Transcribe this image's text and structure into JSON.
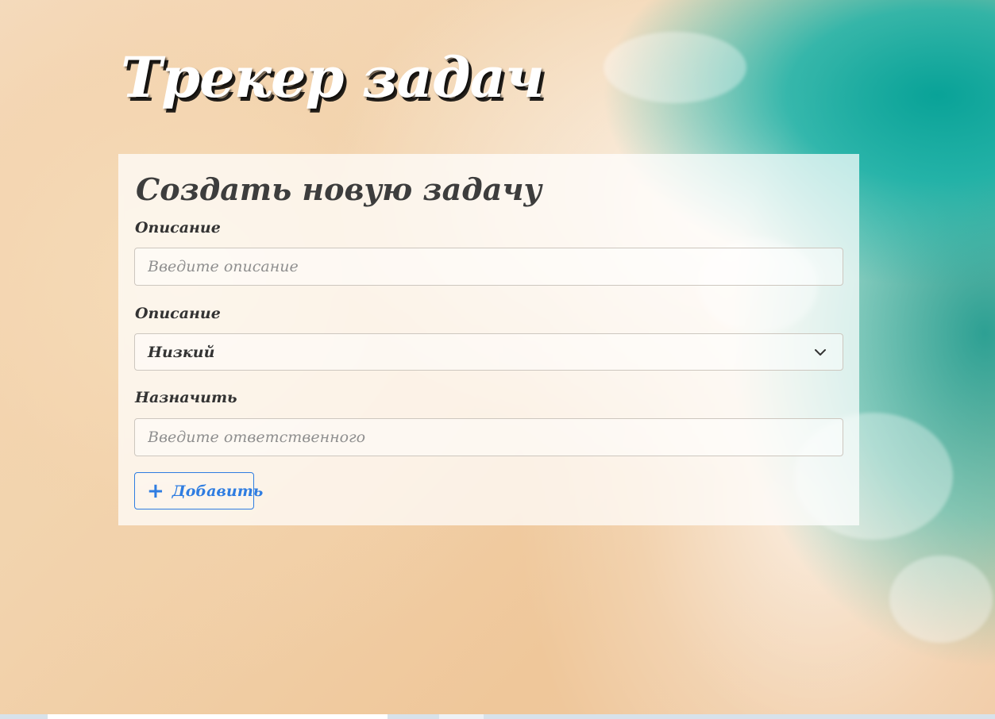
{
  "page": {
    "title": "Трекер задач"
  },
  "form": {
    "title": "Создать новую задачу",
    "description": {
      "label": "Описание",
      "placeholder": "Введите описание",
      "value": ""
    },
    "priority": {
      "label": "Описание",
      "selected": "Низкий"
    },
    "assignee": {
      "label": "Назначить",
      "placeholder": "Введите ответственного",
      "value": ""
    },
    "add_button": {
      "label": "Добавить",
      "icon": "plus-icon"
    }
  },
  "colors": {
    "accent": "#2f7de1",
    "title_text": "#ffffff",
    "card_text": "#3d3d3d"
  }
}
